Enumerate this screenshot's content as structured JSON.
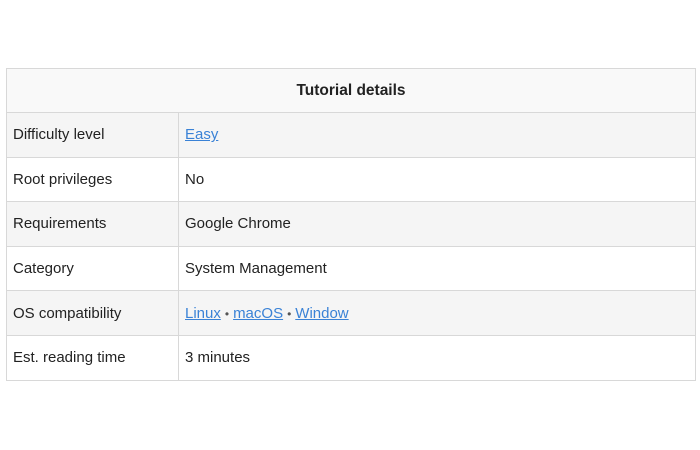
{
  "table": {
    "title": "Tutorial details",
    "rows": {
      "difficulty": {
        "label": "Difficulty level",
        "value": "Easy"
      },
      "root": {
        "label": "Root privileges",
        "value": "No"
      },
      "requirements": {
        "label": "Requirements",
        "value": "Google Chrome"
      },
      "category": {
        "label": "Category",
        "value": "System Management"
      },
      "os": {
        "label": "OS compatibility",
        "values": [
          "Linux",
          "macOS",
          "Window"
        ],
        "separator": "•"
      },
      "reading_time": {
        "label": "Est. reading time",
        "value": "3 minutes"
      }
    }
  },
  "colors": {
    "link": "#3a82d6",
    "border": "#d8d8d8",
    "stripe": "#f5f5f5"
  }
}
